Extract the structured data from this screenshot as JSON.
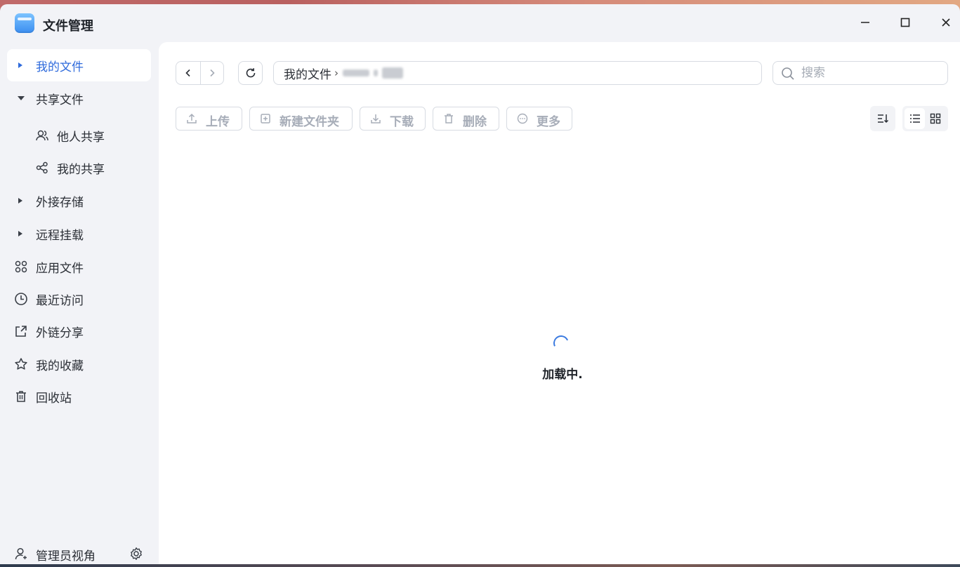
{
  "window": {
    "title": "文件管理"
  },
  "sidebar": {
    "items": [
      {
        "label": "我的文件",
        "icon": "caret-right-icon",
        "active": true
      },
      {
        "label": "共享文件",
        "icon": "caret-down-icon"
      },
      {
        "label": "他人共享",
        "icon": "users-icon"
      },
      {
        "label": "我的共享",
        "icon": "share-icon"
      },
      {
        "label": "外接存储",
        "icon": "caret-right-icon"
      },
      {
        "label": "远程挂载",
        "icon": "caret-right-icon"
      },
      {
        "label": "应用文件",
        "icon": "apps-icon"
      },
      {
        "label": "最近访问",
        "icon": "clock-icon"
      },
      {
        "label": "外链分享",
        "icon": "external-share-icon"
      },
      {
        "label": "我的收藏",
        "icon": "star-icon"
      },
      {
        "label": "回收站",
        "icon": "trash-icon"
      }
    ],
    "footer": {
      "label": "管理员视角",
      "icon": "user-icon",
      "settings_icon": "gear-icon"
    }
  },
  "toolbar": {
    "breadcrumb_root": "我的文件",
    "breadcrumb_sep": "›",
    "search_placeholder": "搜索",
    "actions": [
      "上传",
      "新建文件夹",
      "下载",
      "删除",
      "更多"
    ]
  },
  "content": {
    "loading_text": "加载中."
  },
  "colors": {
    "accent": "#2f6bdc",
    "disabled_text": "#a7adb8",
    "sidebar_bg": "#f2f3f7"
  }
}
